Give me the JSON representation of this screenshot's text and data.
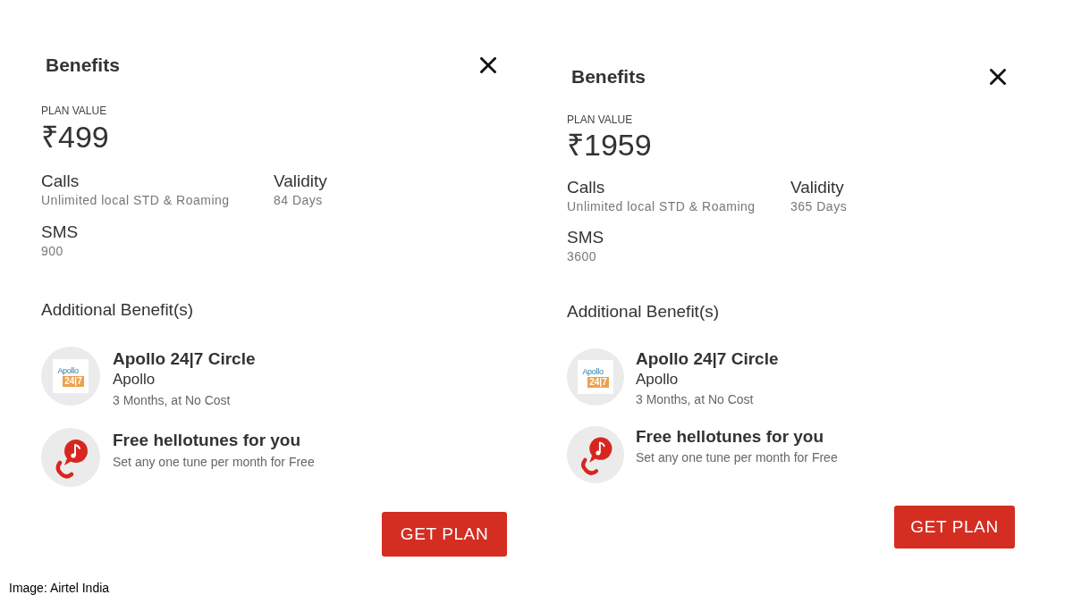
{
  "panels": [
    {
      "title": "Benefits",
      "plan_value_label": "PLAN VALUE",
      "plan_value": "₹499",
      "details": [
        {
          "label": "Calls",
          "value": "Unlimited local STD & Roaming"
        },
        {
          "label": "Validity",
          "value": "84 Days"
        },
        {
          "label": "SMS",
          "value": "900"
        }
      ],
      "additional_heading": "Additional Benefit(s)",
      "additional_benefits": [
        {
          "kind": "apollo",
          "logo_text": [
            "Apollo",
            "24|7"
          ],
          "title": "Apollo 24|7 Circle",
          "provider": "Apollo",
          "note": "3 Months, at No Cost"
        },
        {
          "kind": "hellotunes",
          "title": "Free hellotunes for you",
          "note": "Set any one tune per month for Free"
        }
      ],
      "button": "GET PLAN"
    },
    {
      "title": "Benefits",
      "plan_value_label": "PLAN VALUE",
      "plan_value": "₹1959",
      "details": [
        {
          "label": "Calls",
          "value": "Unlimited local STD & Roaming"
        },
        {
          "label": "Validity",
          "value": "365 Days"
        },
        {
          "label": "SMS",
          "value": "3600"
        }
      ],
      "additional_heading": "Additional Benefit(s)",
      "additional_benefits": [
        {
          "kind": "apollo",
          "logo_text": [
            "Apollo",
            "24|7"
          ],
          "title": "Apollo 24|7 Circle",
          "provider": "Apollo",
          "note": "3 Months, at No Cost"
        },
        {
          "kind": "hellotunes",
          "title": "Free hellotunes for you",
          "note": "Set any one tune per month for Free"
        }
      ],
      "button": "GET PLAN"
    }
  ],
  "image_credit": "Image: Airtel India"
}
